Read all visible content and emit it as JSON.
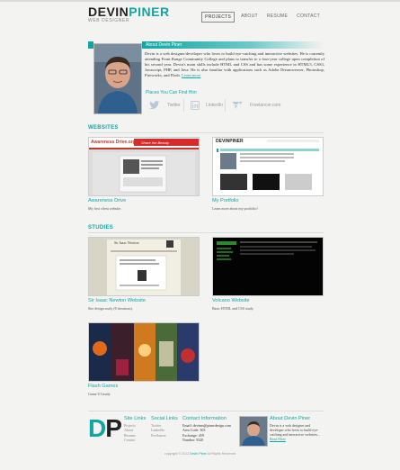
{
  "header": {
    "logo_first": "DEVIN",
    "logo_last": "PINER",
    "logo_subtitle": "WEB DESIGNER",
    "nav": [
      {
        "label": "PROJECTS",
        "active": true
      },
      {
        "label": "ABOUT",
        "active": false
      },
      {
        "label": "RESUME",
        "active": false
      },
      {
        "label": "CONTACT",
        "active": false
      }
    ]
  },
  "about": {
    "title": "About Devin Piner",
    "body": "Devin is a web designer/developer who loves to build eye-catching and interactive websites. He is currently attending Front Range Community College and plans to transfer to a four-year college upon completion of his second year. Devin's main skills include HTML and CSS and has some experience in HTML5, CSS3, Javascript, PHP, and Java. He is also familiar with applications such as Adobe Dreamweaver, Photoshop, Fireworks, and Flash.",
    "learn_more": "Learn more",
    "find_label": "Places You Can Find Him",
    "social": [
      {
        "icon": "twitter-icon",
        "label": "Twitter"
      },
      {
        "icon": "linkedin-icon",
        "label": "LinkedIn"
      },
      {
        "icon": "freelancer-icon",
        "label": "Freelancer.com"
      }
    ]
  },
  "websites": {
    "heading": "WEBSITES",
    "items": [
      {
        "title": "Awareness Drive",
        "desc": "My first client website.",
        "thumb_logo": "Awareness Drive.org",
        "thumb_banner": "Share the Beauty."
      },
      {
        "title": "My Portfolio",
        "desc": "Learn more about my portfolio!",
        "thumb_logo": "DEVINPINER"
      }
    ]
  },
  "studies": {
    "heading": "STUDIES",
    "items": [
      {
        "title": "Sir Isaac Newton Website",
        "desc": "Site design study (8 iterations).",
        "thumb_logo": "Sir Isaac Newton"
      },
      {
        "title": "Volcano Website",
        "desc": "Basic HTML and CSS study."
      },
      {
        "title": "Flash Games",
        "desc": "Game UI study."
      }
    ]
  },
  "footer": {
    "logo_d": "D",
    "logo_p": "P",
    "site_links": {
      "heading": "Site Links",
      "items": [
        "Projects",
        "About",
        "Resume",
        "Contact"
      ]
    },
    "social_links": {
      "heading": "Social Links",
      "items": [
        "Twitter",
        "LinkedIn",
        "Freelancer"
      ]
    },
    "contact": {
      "heading": "Contact Information",
      "items": [
        "Email: devinm@pinerdesign.com",
        "Area Code: 303",
        "Exchange: 459",
        "Number: 9320"
      ]
    },
    "about": {
      "heading": "About Devin Piner",
      "text": "Devin is a web designer and developer who loves to build eye-catching and interactive websites...",
      "more": "Read More"
    },
    "copyright_prefix": "copyright © 2012",
    "copyright_name": "Devin Piner",
    "copyright_suffix": "All Rights Reserved"
  },
  "colors": {
    "accent": "#11a6a3",
    "background": "#f3f3f1",
    "text": "#333333"
  }
}
